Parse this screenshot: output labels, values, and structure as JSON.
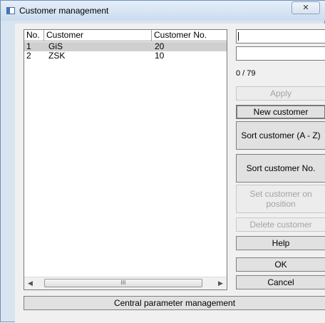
{
  "window": {
    "title": "Customer management",
    "close_glyph": "✕"
  },
  "table": {
    "columns": [
      "No.",
      "Customer",
      "Customer No."
    ],
    "rows": [
      {
        "no": "1",
        "customer": "GiS",
        "customer_no": "20",
        "selected": true
      },
      {
        "no": "2",
        "customer": "ZSK",
        "customer_no": "10",
        "selected": false
      }
    ],
    "scrollbar_grip": "III"
  },
  "inputs": {
    "search_value": "",
    "second_value": ""
  },
  "counter": "0 / 79",
  "buttons": {
    "apply": "Apply",
    "new_customer": "New customer",
    "sort_az": "Sort customer (A - Z)",
    "sort_no": "Sort customer No.",
    "set_position": "Set customer on position",
    "delete": "Delete customer",
    "help": "Help",
    "ok": "OK",
    "cancel": "Cancel",
    "central": "Central parameter management"
  }
}
